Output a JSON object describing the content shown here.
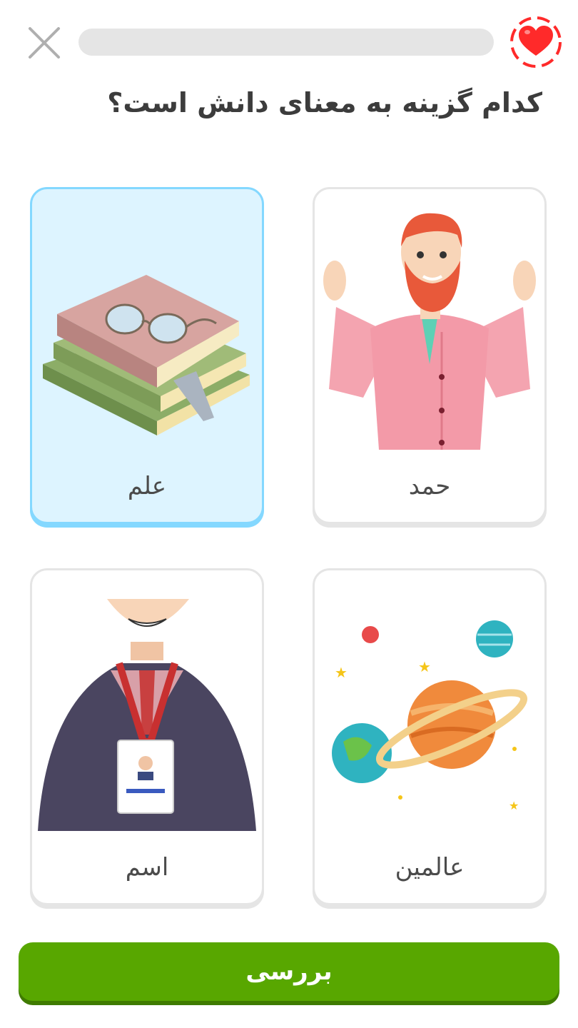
{
  "header": {
    "progress": 0,
    "close_icon": "close-icon",
    "heart_icon": "heart-icon",
    "heart_color": "#ff2a2a"
  },
  "question": "کدام گزینه به معنای دانش است؟",
  "options": [
    {
      "label": "حمد",
      "image": "bearded-man-raising-hands",
      "selected": false
    },
    {
      "label": "علم",
      "image": "stack-of-books-with-glasses",
      "selected": true
    },
    {
      "label": "عالمین",
      "image": "planets-and-stars",
      "selected": false
    },
    {
      "label": "اسم",
      "image": "man-with-name-badge",
      "selected": false
    }
  ],
  "footer": {
    "check_label": "بررسی",
    "check_color": "#58a700"
  }
}
